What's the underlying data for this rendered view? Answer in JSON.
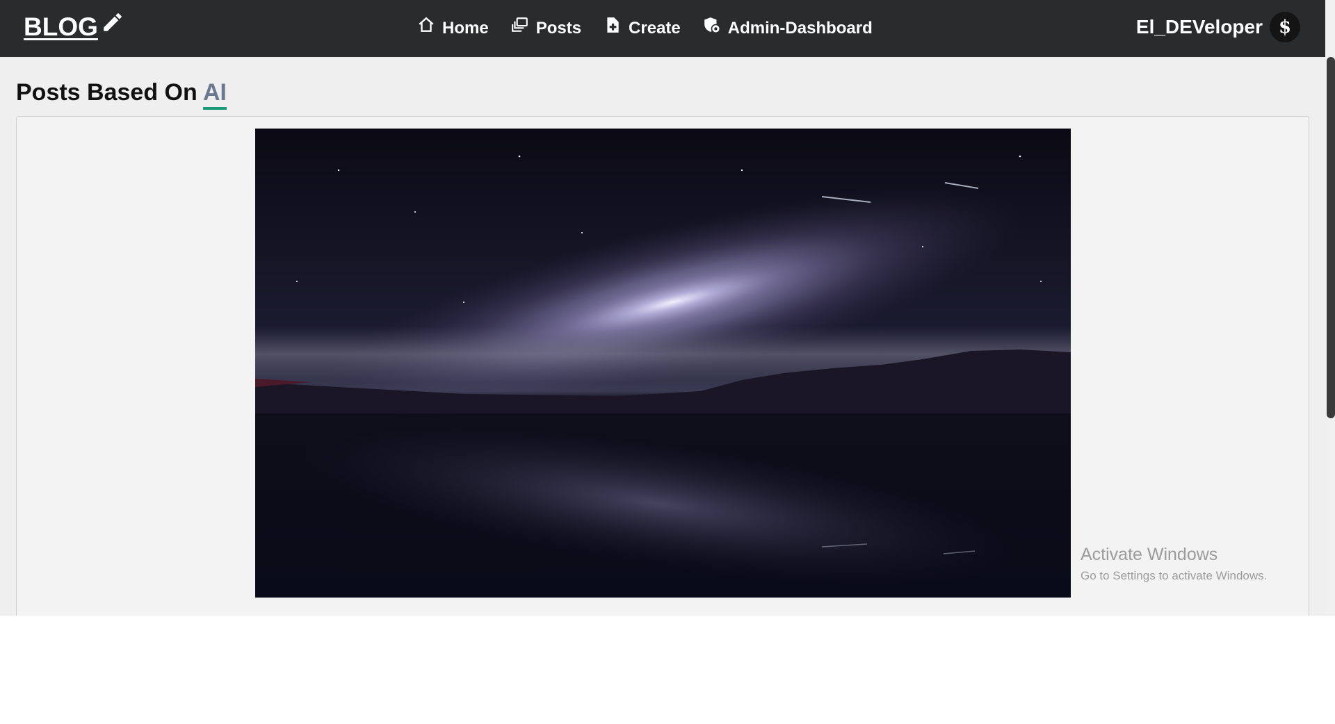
{
  "navbar": {
    "brand": "BLOG",
    "brand_icon": "pencil-icon",
    "links": [
      {
        "label": "Home",
        "icon": "home-icon"
      },
      {
        "label": "Posts",
        "icon": "posts-icon"
      },
      {
        "label": "Create",
        "icon": "file-plus-icon"
      },
      {
        "label": "Admin-Dashboard",
        "icon": "admin-shield-icon"
      }
    ],
    "username": "El_DEVeloper",
    "avatar_glyph": "$"
  },
  "main": {
    "title_prefix": "Posts Based On",
    "topic": "AI",
    "post_image_alt": "Galaxy over a calm lake at night"
  },
  "watermark": {
    "line1": "Activate Windows",
    "line2": "Go to Settings to activate Windows."
  },
  "colors": {
    "navbar_bg": "#2a2b2d",
    "topic_text": "#6b7a90",
    "topic_underline": "#1a9a7a"
  }
}
